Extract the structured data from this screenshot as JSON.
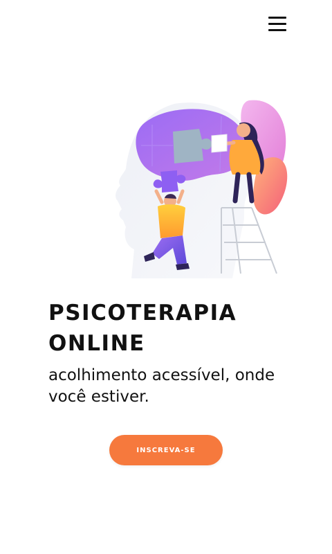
{
  "header": {
    "menu_icon": "hamburger-menu-icon"
  },
  "hero": {
    "illustration": "mental-health-puzzle-illustration",
    "title_line1": "PSICOTERAPIA",
    "title_line2": "ONLINE",
    "subtitle": "acolhimento acessível, onde você estiver.",
    "cta_label": "INSCREVA-SE"
  },
  "colors": {
    "accent": "#f6793d",
    "text": "#111111",
    "background": "#ffffff",
    "purple": "#8e5ff2",
    "pink": "#e89ae6"
  }
}
